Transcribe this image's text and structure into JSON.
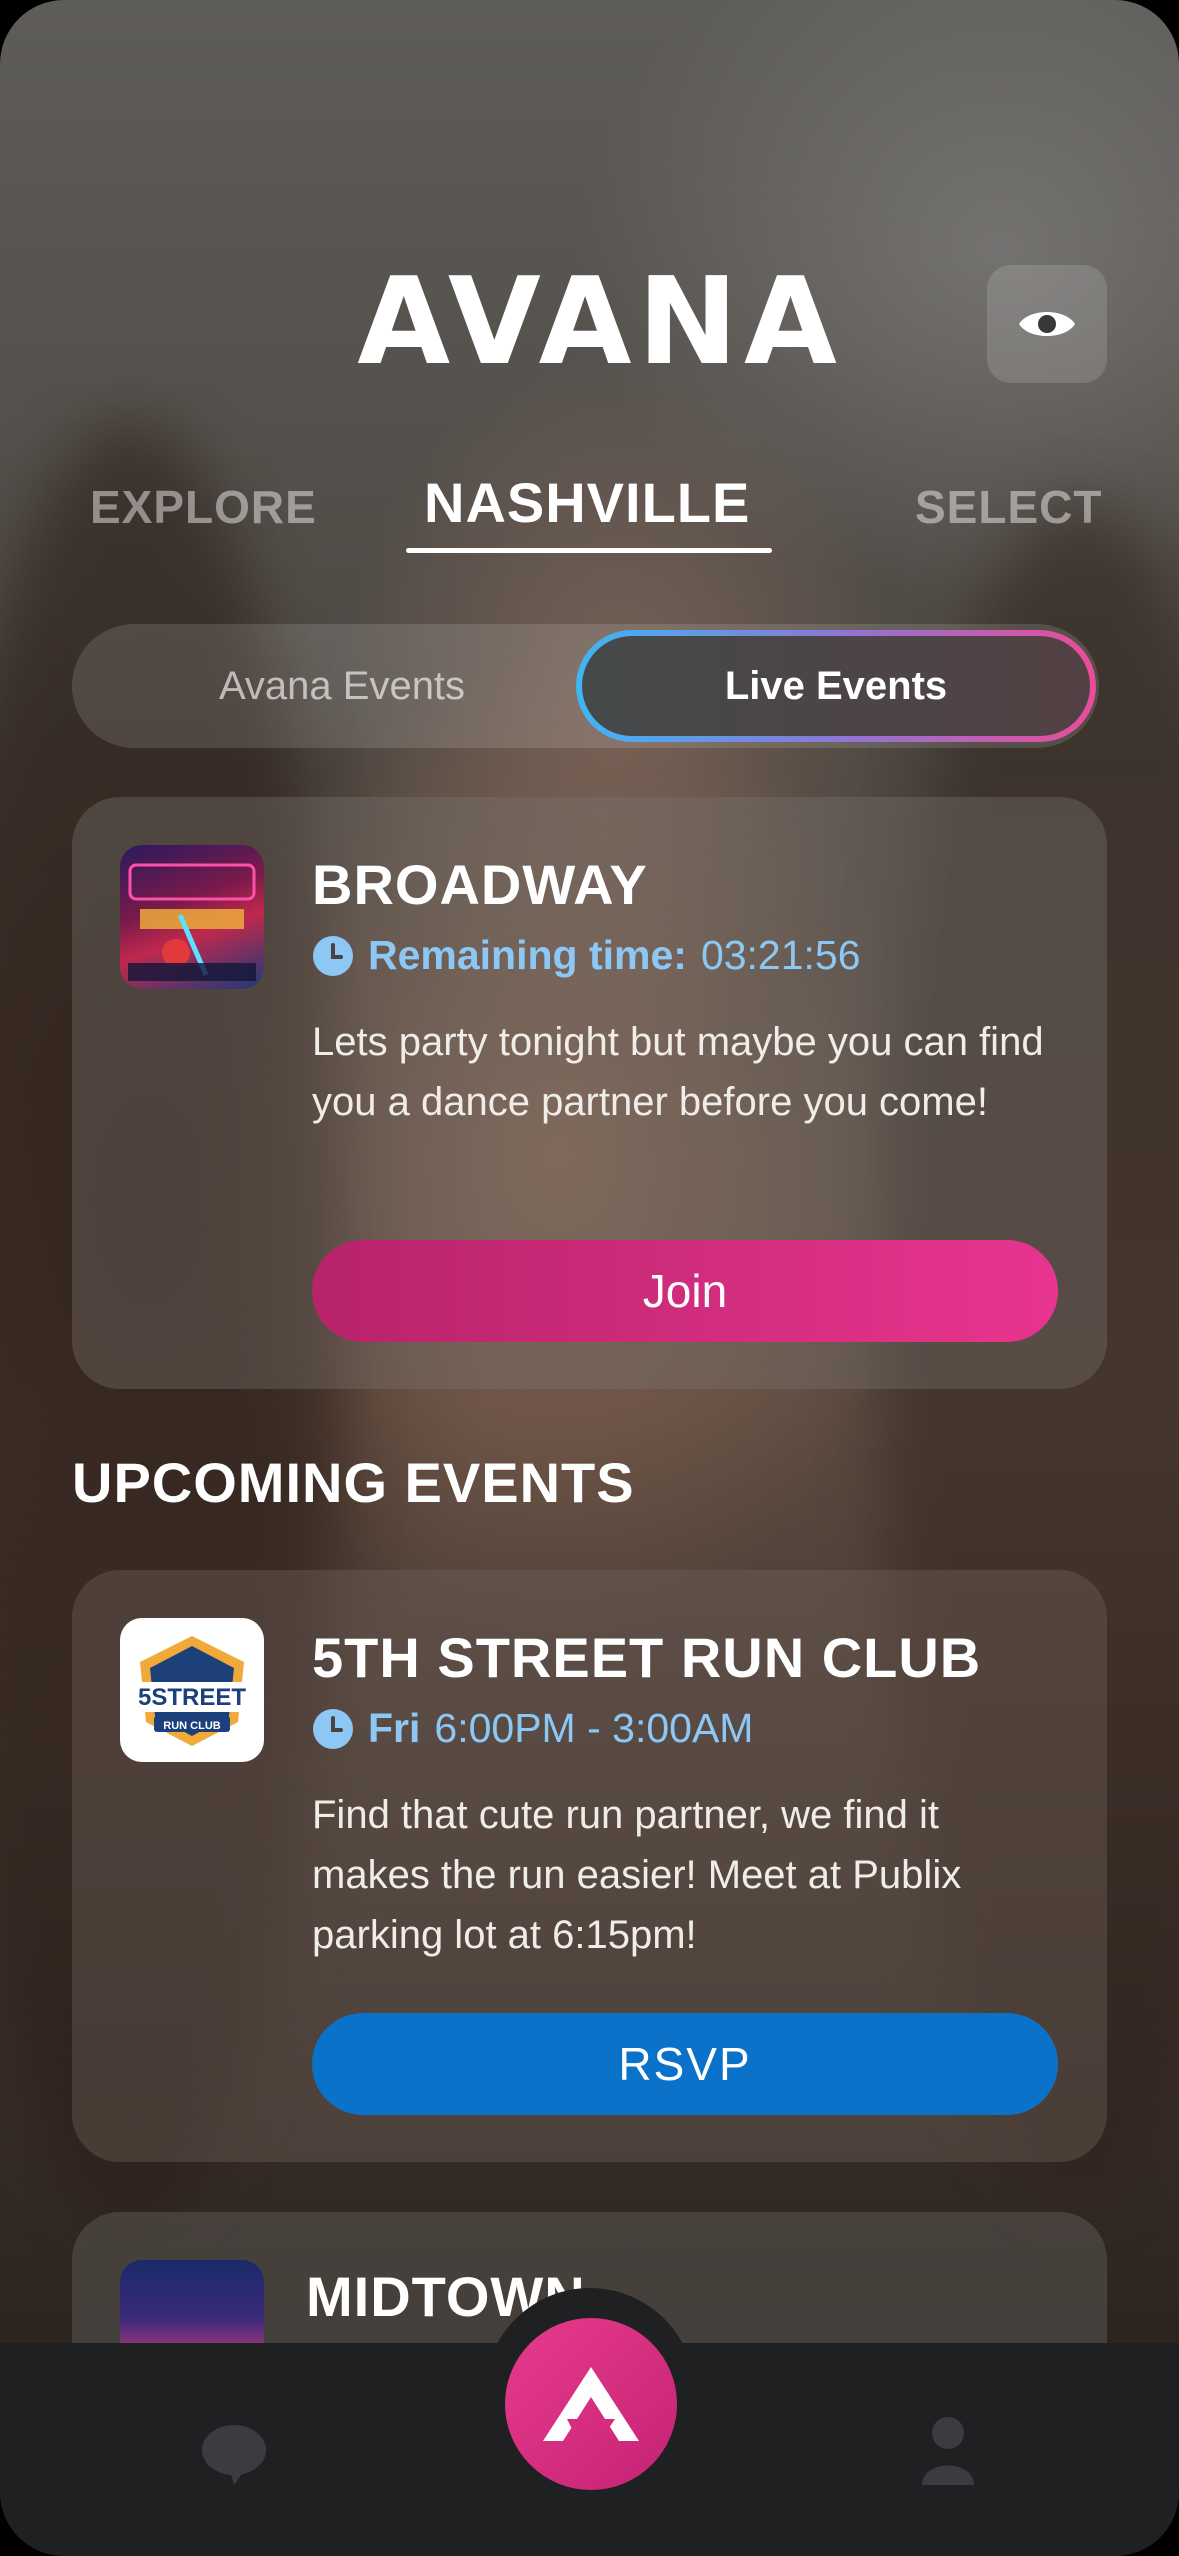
{
  "header": {
    "logo_text": "AVANA",
    "visibility_button_icon": "eye-icon"
  },
  "nav": {
    "items": [
      {
        "label": "EXPLORE",
        "active": false
      },
      {
        "label": "NASHVILLE",
        "active": true
      },
      {
        "label": "SELECT",
        "active": false
      }
    ]
  },
  "segment": {
    "options": [
      "Avana Events",
      "Live Events"
    ],
    "selected": "Live Events"
  },
  "live_event": {
    "title": "BROADWAY",
    "meta_label": "Remaining time:",
    "meta_value": "03:21:56",
    "description": "Lets party tonight but maybe you can find you a dance partner before you come!",
    "button_label": "Join",
    "icon": "clock-icon"
  },
  "upcoming": {
    "section_title": "UPCOMING EVENTS",
    "events": [
      {
        "title": "5TH STREET RUN CLUB",
        "meta_label": "Fri",
        "meta_value": "6:00PM - 3:00AM",
        "description": "Find that cute run partner, we find it makes the run easier! Meet at Publix parking lot at 6:15pm!",
        "button_label": "RSVP",
        "logo_text": "5STREET",
        "logo_sub": "RUN CLUB"
      },
      {
        "title": "MIDTOWN"
      }
    ]
  },
  "tabbar": {
    "items": [
      "chat-icon",
      "avana-logo-icon",
      "profile-icon"
    ]
  },
  "colors": {
    "accent_pink": "#e8358f",
    "accent_blue": "#0a72c8",
    "meta_blue": "#8dc8f5",
    "tabbar_bg": "#1f2022"
  }
}
